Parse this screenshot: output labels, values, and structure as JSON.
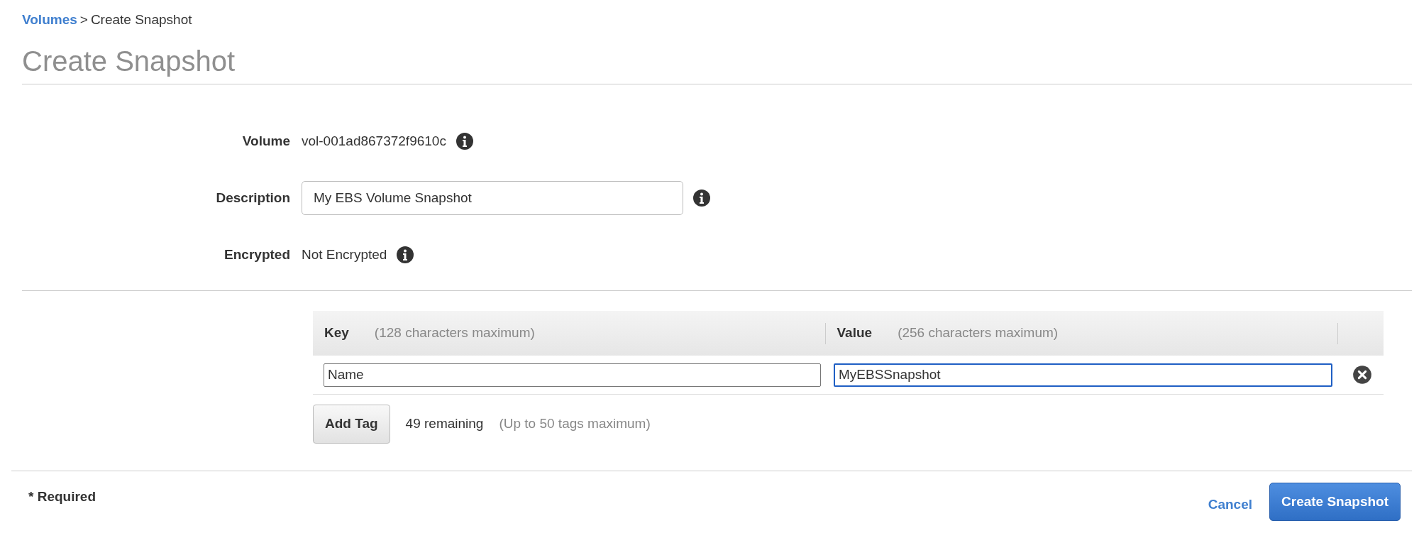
{
  "breadcrumb": {
    "link": "Volumes",
    "separator": ">",
    "current": "Create Snapshot"
  },
  "title": "Create Snapshot",
  "fields": [
    {
      "kind": "text",
      "label": "Volume",
      "value": "vol-001ad867372f9610c",
      "info": true
    },
    {
      "kind": "input",
      "label": "Description",
      "value": "My EBS Volume Snapshot",
      "info": true
    },
    {
      "kind": "text",
      "label": "Encrypted",
      "value": "Not Encrypted",
      "info": true
    }
  ],
  "tags": {
    "columns": [
      {
        "label": "Key",
        "hint": "(128 characters maximum)"
      },
      {
        "label": "Value",
        "hint": "(256 characters maximum)"
      }
    ],
    "rows": [
      {
        "key": {
          "text": "Name",
          "focused": false
        },
        "value": {
          "text": "MyEBSSnapshot",
          "focused": true
        }
      }
    ],
    "add_button": "Add Tag",
    "remaining": "49 remaining",
    "limit": "(Up to 50 tags maximum)"
  },
  "footer": {
    "required": "* Required",
    "cancel": "Cancel",
    "submit": "Create Snapshot"
  }
}
